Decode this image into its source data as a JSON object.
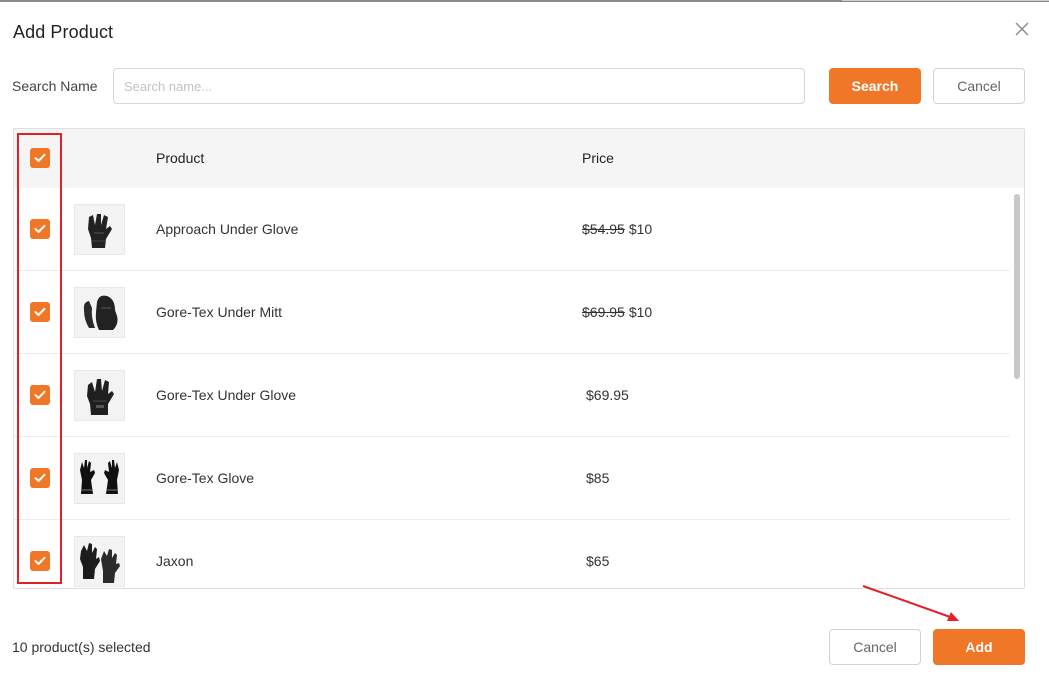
{
  "modal": {
    "title": "Add Product"
  },
  "search": {
    "label": "Search Name",
    "placeholder": "Search name...",
    "value": "",
    "search_button": "Search",
    "cancel_button": "Cancel"
  },
  "table": {
    "columns": [
      "Product",
      "Price"
    ],
    "rows": [
      {
        "name": "Approach Under Glove",
        "old_price": "$54.95",
        "price": "$10",
        "checked": true,
        "thumb": "glove-thumb"
      },
      {
        "name": "Gore-Tex Under Mitt",
        "old_price": "$69.95",
        "price": "$10",
        "checked": true,
        "thumb": "mitt-thumb"
      },
      {
        "name": "Gore-Tex Under Glove",
        "old_price": "",
        "price": "$69.95",
        "checked": true,
        "thumb": "glove-thumb"
      },
      {
        "name": "Gore-Tex Glove",
        "old_price": "",
        "price": "$85",
        "checked": true,
        "thumb": "glove-pair-thumb"
      },
      {
        "name": "Jaxon",
        "old_price": "",
        "price": "$65",
        "checked": true,
        "thumb": "glove-pair-thumb"
      }
    ]
  },
  "footer": {
    "selected_text": "10 product(s) selected",
    "cancel_button": "Cancel",
    "add_button": "Add"
  },
  "icons": {
    "close": "close-icon",
    "checkbox": "checkmark-icon"
  },
  "colors": {
    "accent": "#f07728",
    "annotation": "#e2202a"
  }
}
